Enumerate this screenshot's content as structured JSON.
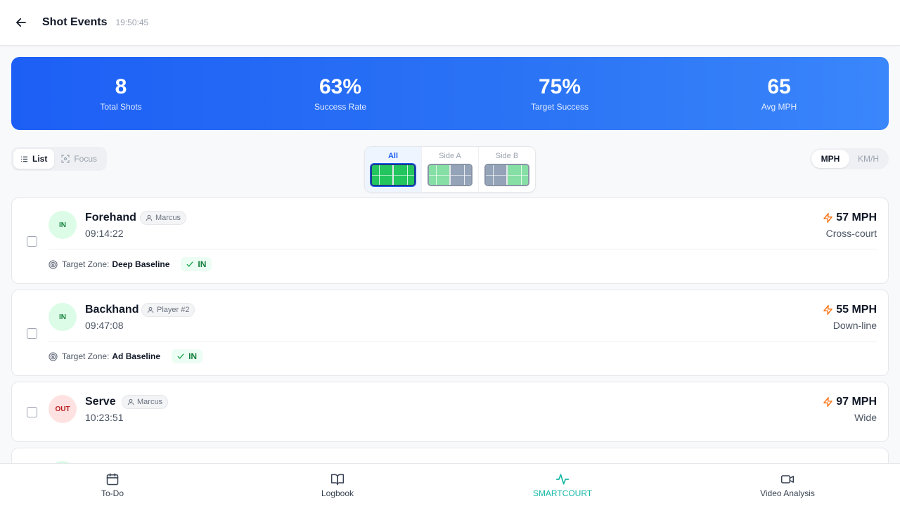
{
  "header": {
    "title": "Shot Events",
    "time": "19:50:45"
  },
  "stats": [
    {
      "value": "8",
      "label": "Total Shots"
    },
    {
      "value": "63%",
      "label": "Success Rate"
    },
    {
      "value": "75%",
      "label": "Target Success"
    },
    {
      "value": "65",
      "label": "Avg MPH"
    }
  ],
  "view_toggle": {
    "list": "List",
    "focus": "Focus",
    "active": "List"
  },
  "side_selector": {
    "options": [
      "All",
      "Side A",
      "Side B"
    ],
    "active": "All"
  },
  "unit_toggle": {
    "mph": "MPH",
    "kmh": "KM/H",
    "active": "MPH"
  },
  "target_zone_label": "Target Zone:",
  "shots": [
    {
      "result": "IN",
      "name": "Forehand",
      "player": "Marcus",
      "time": "09:14:22",
      "speed": "57 MPH",
      "direction": "Cross-court",
      "target_zone": "Deep Baseline",
      "target_result": "IN"
    },
    {
      "result": "IN",
      "name": "Backhand",
      "player": "Player #2",
      "time": "09:47:08",
      "speed": "55 MPH",
      "direction": "Down-line",
      "target_zone": "Ad Baseline",
      "target_result": "IN"
    },
    {
      "result": "OUT",
      "name": "Serve",
      "player": "Marcus",
      "time": "10:23:51",
      "speed": "97 MPH",
      "direction": "Wide"
    }
  ],
  "bottom_nav": [
    {
      "label": "To-Do",
      "icon": "calendar-icon"
    },
    {
      "label": "Logbook",
      "icon": "book-icon"
    },
    {
      "label": "SMARTCOURT",
      "icon": "activity-icon",
      "active": true
    },
    {
      "label": "Video Analysis",
      "icon": "video-icon"
    }
  ],
  "colors": {
    "accent": "#1d5ff5",
    "in": "#15803d",
    "out": "#b91c1c",
    "smartcourt": "#14b8a6",
    "speed_icon": "#f97316"
  }
}
